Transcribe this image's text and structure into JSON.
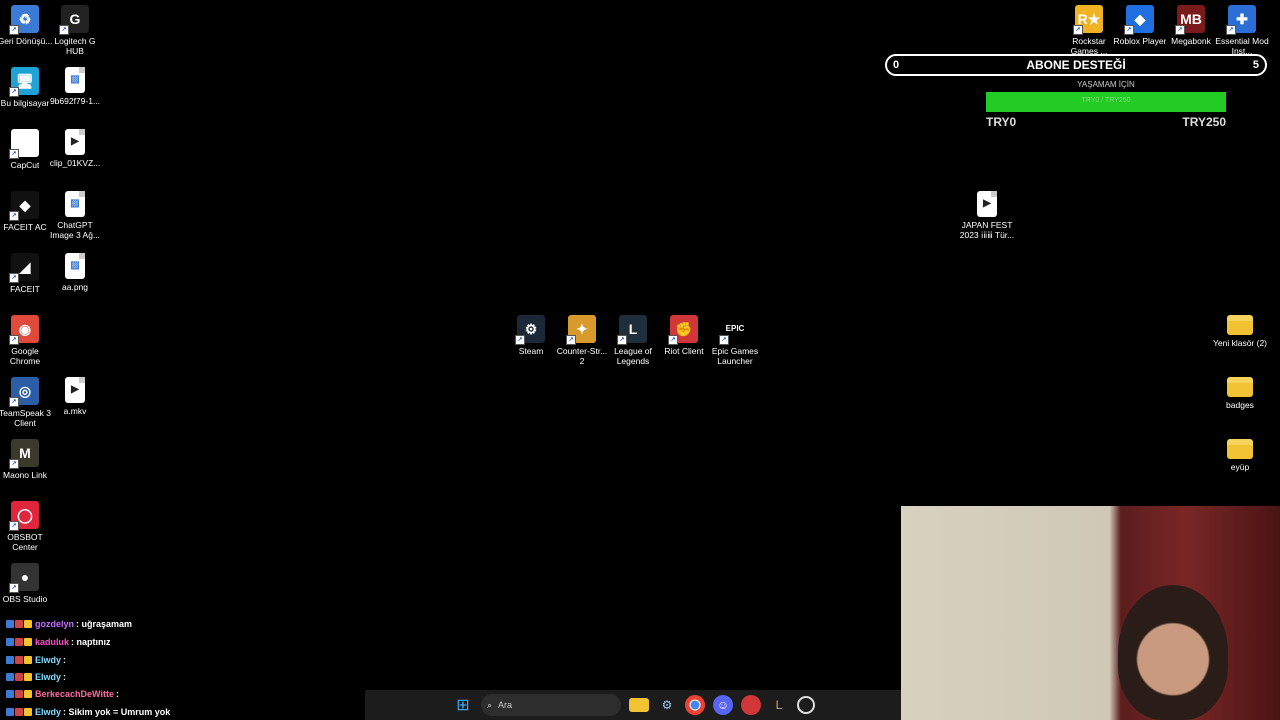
{
  "desktop_left": [
    {
      "label": "Geri Dönüşü...",
      "icon": "recycle-bin-icon",
      "glyph": "♻",
      "bg": "#3a7bd5"
    },
    {
      "label": "Logitech G HUB",
      "icon": "logitech-g-icon",
      "glyph": "G",
      "bg": "#222"
    },
    {
      "label": "Bu bilgisayar",
      "icon": "computer-icon",
      "glyph": "🖥",
      "bg": "#1fa3d6"
    },
    {
      "label": "9b692f79-1...",
      "icon": "image-file-icon",
      "glyph": "",
      "bg": "#fff"
    },
    {
      "label": "CapCut",
      "icon": "capcut-icon",
      "glyph": "✂",
      "bg": "#fff"
    },
    {
      "label": "clip_01KVZ...",
      "icon": "video-file-icon",
      "glyph": "▶",
      "bg": "#fff"
    },
    {
      "label": "FACEIT AC",
      "icon": "faceit-ac-icon",
      "glyph": "◆",
      "bg": "#111"
    },
    {
      "label": "ChatGPT Image 3 Ağ...",
      "icon": "image-file-icon",
      "glyph": "",
      "bg": "#fff"
    },
    {
      "label": "FACEIT",
      "icon": "faceit-icon",
      "glyph": "◢",
      "bg": "#111"
    },
    {
      "label": "aa.png",
      "icon": "image-file-icon",
      "glyph": "",
      "bg": "#fff"
    },
    {
      "label": "Google Chrome",
      "icon": "chrome-icon",
      "glyph": "◉",
      "bg": "#e04a3a"
    },
    {
      "label": "TeamSpeak 3 Client",
      "icon": "teamspeak-icon",
      "glyph": "◎",
      "bg": "#2b5ea7"
    },
    {
      "label": "a.mkv",
      "icon": "video-file-icon",
      "glyph": "▶",
      "bg": "#fff"
    },
    {
      "label": "Maono Link",
      "icon": "maono-link-icon",
      "glyph": "M",
      "bg": "#3a3a2a"
    },
    {
      "label": "OBSBOT Center",
      "icon": "obsbot-icon",
      "glyph": "◯",
      "bg": "#e0263d"
    },
    {
      "label": "OBS Studio",
      "icon": "obs-studio-icon",
      "glyph": "●",
      "bg": "#333"
    }
  ],
  "desktop_center": [
    {
      "label": "Steam",
      "icon": "steam-icon",
      "glyph": "⚙",
      "bg": "#1b2838"
    },
    {
      "label": "Counter-Str... 2",
      "icon": "counter-strike-icon",
      "glyph": "✦",
      "bg": "#d89b2b"
    },
    {
      "label": "League of Legends",
      "icon": "league-of-legends-icon",
      "glyph": "L",
      "bg": "#1e2e3a"
    },
    {
      "label": "Riot Client",
      "icon": "riot-client-icon",
      "glyph": "✊",
      "bg": "#d13639"
    },
    {
      "label": "Epic Games Launcher",
      "icon": "epic-games-icon",
      "glyph": "EPIC",
      "bg": "#000"
    }
  ],
  "desktop_right_top": [
    {
      "label": "Rockstar Games ...",
      "icon": "rockstar-icon",
      "glyph": "R★",
      "bg": "#f0b323"
    },
    {
      "label": "Roblox Player",
      "icon": "roblox-icon",
      "glyph": "◆",
      "bg": "#1f6fe0"
    },
    {
      "label": "Megabonk",
      "icon": "megabonk-icon",
      "glyph": "MB",
      "bg": "#7a1a1a"
    },
    {
      "label": "Essential Mod Inst...",
      "icon": "essential-mod-icon",
      "glyph": "✚",
      "bg": "#2b6fd6"
    }
  ],
  "desktop_right": [
    {
      "label": "JAPAN FEST 2023 ⅰⅱⅲ Tür...",
      "icon": "video-file-icon"
    },
    {
      "label": "Yeni klasör (2)",
      "icon": "folder-icon"
    },
    {
      "label": "badges",
      "icon": "folder-icon"
    },
    {
      "label": "eyüp",
      "icon": "folder-icon"
    }
  ],
  "goal": {
    "left": "0",
    "title": "ABONE DESTEĞİ",
    "right": "5"
  },
  "donation": {
    "caption": "YAŞAMAM İÇİN",
    "bar_label": "TRY0 / TRY250",
    "progress": 1.0,
    "min": "TRY0",
    "max": "TRY250",
    "color": "#22cc22"
  },
  "chat": [
    {
      "user": "gozdelyn",
      "user_color": "#c46bff",
      "text": ": uğraşamam"
    },
    {
      "user": "kaduluk",
      "user_color": "#ff4ec9",
      "text": ": naptınız"
    },
    {
      "user": "Elwdy",
      "user_color": "#7fdcff",
      "text": ":"
    },
    {
      "user": "Elwdy",
      "user_color": "#7fdcff",
      "text": ":"
    },
    {
      "user": "BerkecachDeWitte",
      "user_color": "#ff6ba0",
      "text": ":"
    },
    {
      "user": "Elwdy",
      "user_color": "#7fdcff",
      "text": ": Sikim yok = Umrum yok"
    }
  ],
  "taskbar": {
    "search_placeholder": "Ara",
    "items": [
      "start-icon",
      "search-icon",
      "file-explorer-icon",
      "steam-icon",
      "chrome-icon",
      "discord-icon",
      "riot-client-icon",
      "league-of-legends-icon",
      "obs-icon"
    ]
  }
}
